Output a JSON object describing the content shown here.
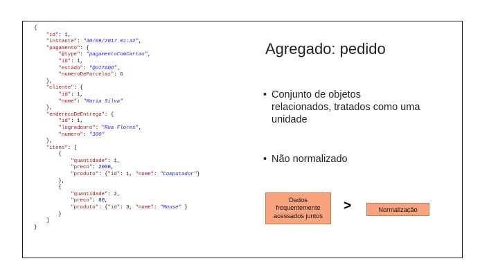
{
  "slide": {
    "title": "Agregado: pedido",
    "bullets": [
      "Conjunto de objetos relacionados, tratados como uma unidade",
      "Não normalizado"
    ],
    "bullet_marker": "•",
    "comparison": {
      "left_box": "Dados frequentemente acessados juntos",
      "operator": ">",
      "right_box": "Normalização"
    }
  },
  "json_example": {
    "id": 1,
    "instante": "30/09/2017 01:32",
    "pagamento": {
      "@type": "pagamentoComCartao",
      "id": 1,
      "estado": "QUITADO",
      "numeroDeParcelas": 6
    },
    "cliente": {
      "id": 1,
      "nome": "Maria Silva"
    },
    "enderecoDeEntrega": {
      "id": 1,
      "logradouro": "Rua Flores",
      "numero": "300"
    },
    "itens": [
      {
        "quantidade": 1,
        "preco": 2000,
        "produto": {
          "id": 1,
          "nome": "Computador"
        }
      },
      {
        "quantidade": 2,
        "preco": 80,
        "produto": {
          "id": 3,
          "nome": "Mouse"
        }
      }
    ]
  },
  "colors": {
    "box_fill": "#f8a47f",
    "box_border": "#d9764a",
    "json_key": "#a31515",
    "json_string": "#1a1aff",
    "json_number": "#0000aa"
  }
}
